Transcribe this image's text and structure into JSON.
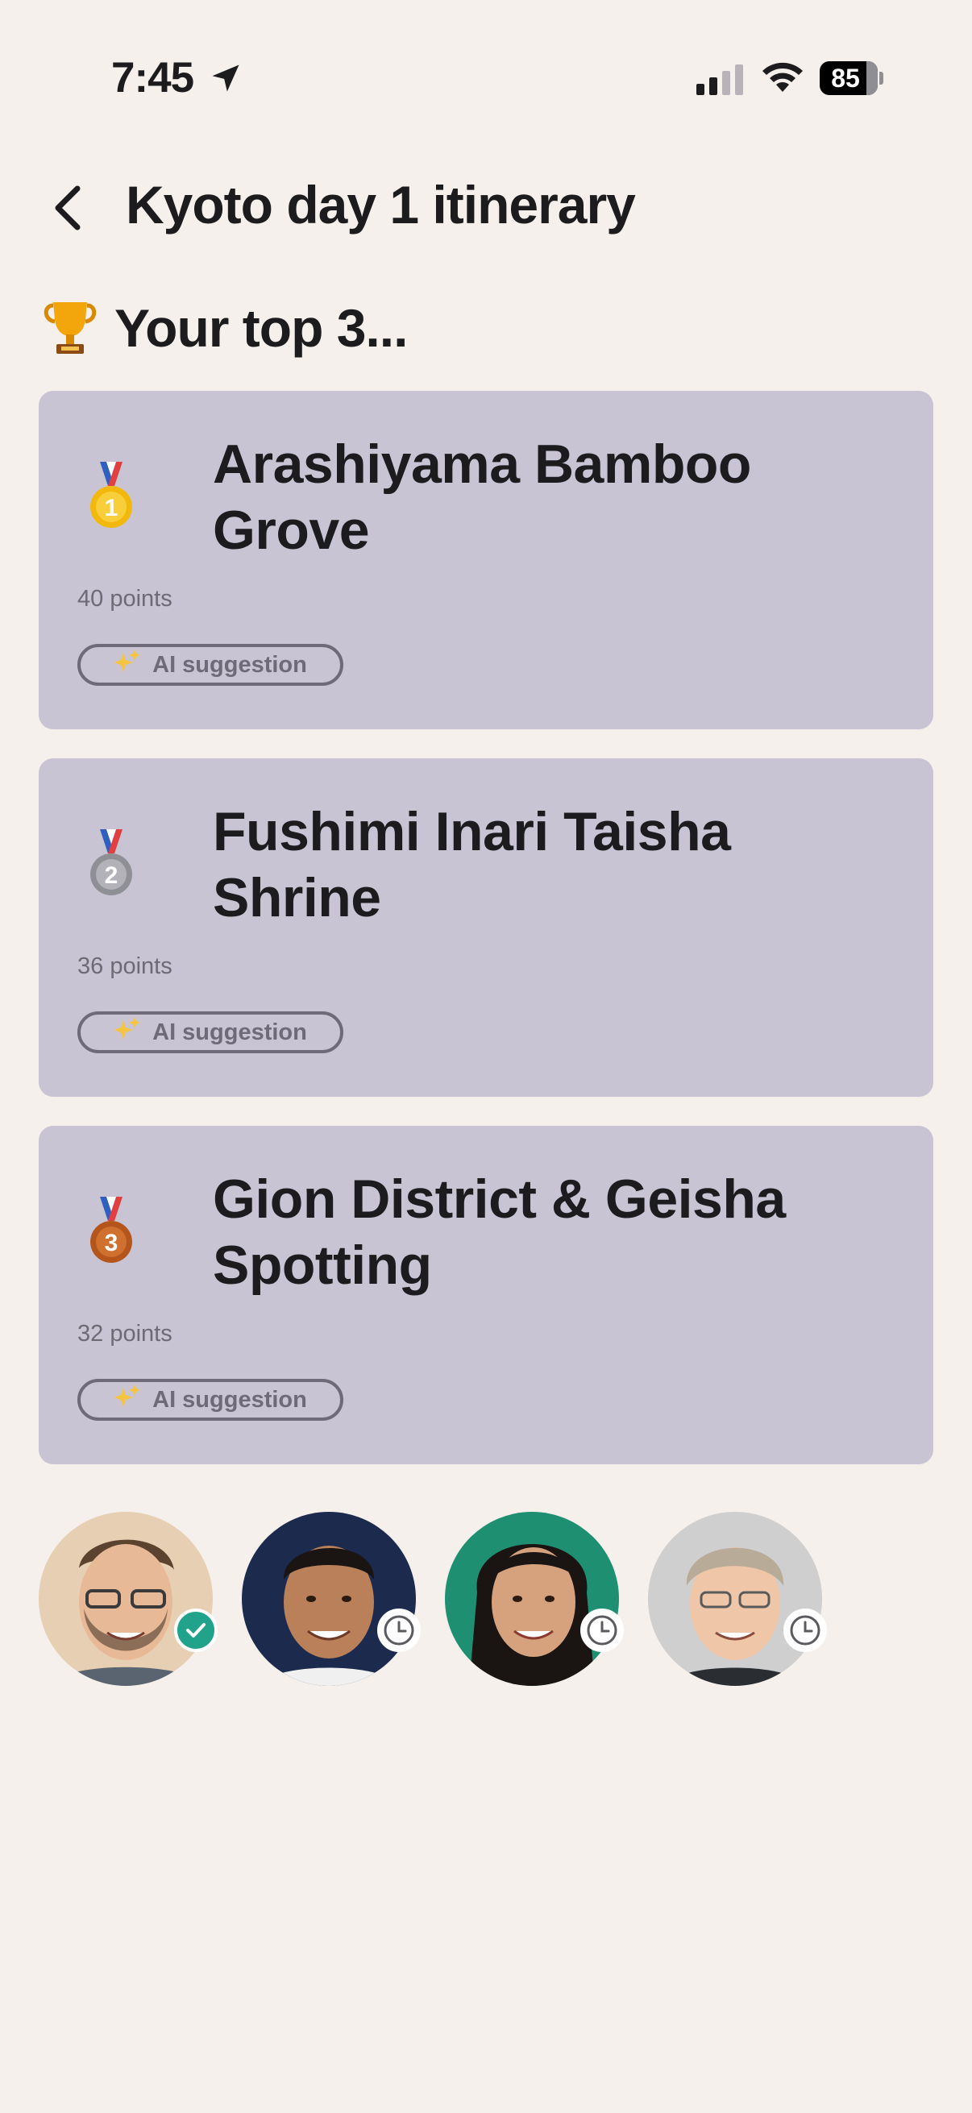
{
  "status_bar": {
    "time": "7:45",
    "battery": "85"
  },
  "header": {
    "title": "Kyoto day 1 itinerary"
  },
  "section": {
    "heading": "Your top 3..."
  },
  "rankings": [
    {
      "rank": "1",
      "medal": "gold-medal-icon",
      "name": "Arashiyama Bamboo Grove",
      "points": "40 points",
      "tag": "AI suggestion"
    },
    {
      "rank": "2",
      "medal": "silver-medal-icon",
      "name": "Fushimi Inari Taisha Shrine",
      "points": "36 points",
      "tag": "AI suggestion"
    },
    {
      "rank": "3",
      "medal": "bronze-medal-icon",
      "name": "Gion District & Geisha Spotting",
      "points": "32 points",
      "tag": "AI suggestion"
    }
  ],
  "participants": [
    {
      "status": "voted",
      "status_icon": "check-icon"
    },
    {
      "status": "pending",
      "status_icon": "clock-icon"
    },
    {
      "status": "pending",
      "status_icon": "clock-icon"
    },
    {
      "status": "pending",
      "status_icon": "clock-icon"
    }
  ],
  "colors": {
    "background": "#f5f0ec",
    "card": "#c9c4d3",
    "voted": "#20a38a",
    "pill": "#6e6a78"
  }
}
